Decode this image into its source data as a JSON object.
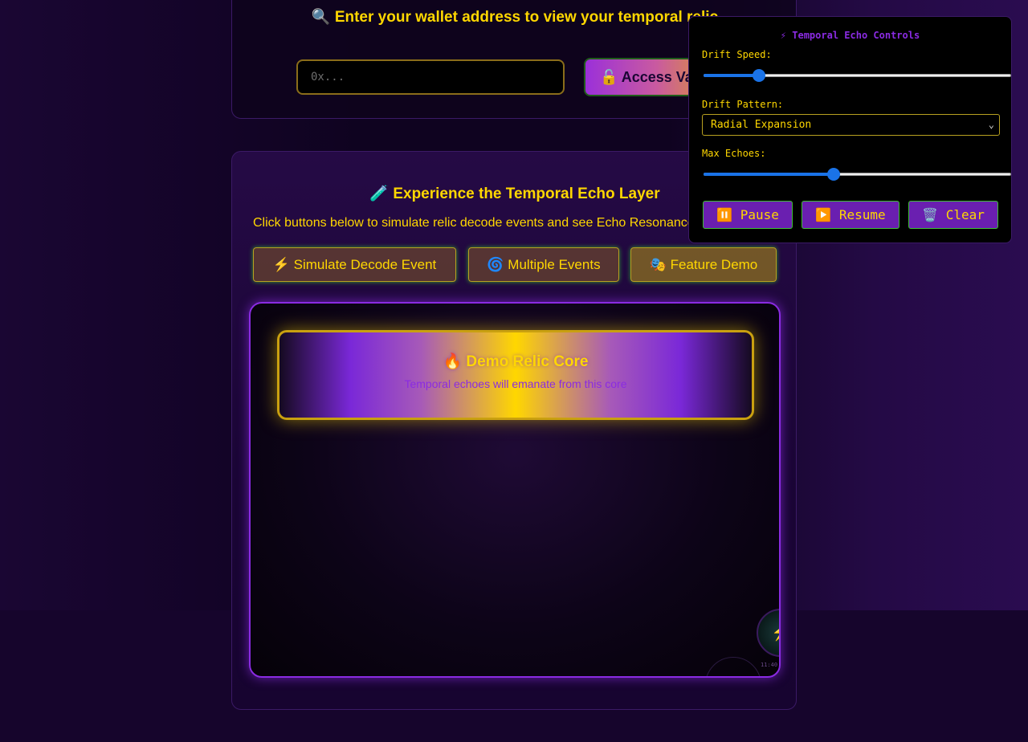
{
  "wallet": {
    "title": "🔍 Enter your wallet address to view your temporal relic",
    "input_placeholder": "0x...",
    "access_label": "🔓 Access Va"
  },
  "demo": {
    "title": "🧪 Experience the Temporal Echo Layer",
    "description": "Click buttons below to simulate relic decode events and see Echo Resonance",
    "buttons": {
      "simulate": "⚡ Simulate Decode Event",
      "multiple": "🌀 Multiple Events",
      "feature": "🎭 Feature Demo"
    },
    "core": {
      "title": "🔥 Demo Relic Core",
      "subtitle": "Temporal echoes will emanate from this core"
    },
    "echo_orb": {
      "icon": "⚡",
      "time": "11:40"
    }
  },
  "controls": {
    "title": "⚡ Temporal Echo Controls",
    "drift_speed_label": "Drift Speed:",
    "drift_speed_fraction": 0.165,
    "drift_pattern_label": "Drift Pattern:",
    "drift_pattern_value": "Radial Expansion",
    "max_echoes_label": "Max Echoes:",
    "max_echoes_fraction": 0.42,
    "pause_label": "⏸️ Pause",
    "resume_label": "▶️ Resume",
    "clear_label": "🗑️ Clear"
  },
  "colors": {
    "gold": "#ffd700",
    "violet": "#8a2be2",
    "slider_blue": "#1a73e8"
  }
}
